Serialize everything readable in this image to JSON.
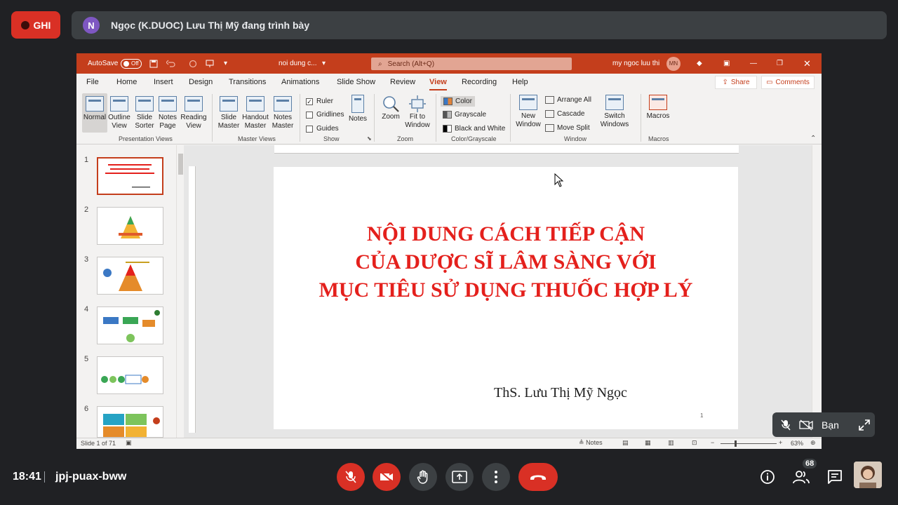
{
  "meet": {
    "record_label": "GHI",
    "presenter_initial": "N",
    "presenter_text": "Ngọc (K.DUOC) Lưu Thị Mỹ đang trình bày",
    "self_label": "Bạn",
    "time": "18:41",
    "meeting_code": "jpj-puax-bww",
    "participants_count": "68",
    "colors": {
      "end_call": "#d93025",
      "bg": "#202124",
      "avatar": "#7e57c2"
    }
  },
  "ppt": {
    "autosave_label": "AutoSave",
    "autosave_state": "Off",
    "file_name": "noi dung c...",
    "search_placeholder": "Search (Alt+Q)",
    "user_name": "my ngoc luu thi",
    "user_initials": "MN",
    "menu": [
      "File",
      "Home",
      "Insert",
      "Design",
      "Transitions",
      "Animations",
      "Slide Show",
      "Review",
      "View",
      "Recording",
      "Help"
    ],
    "active_menu": "View",
    "share_label": "Share",
    "comments_label": "Comments",
    "ribbon": {
      "presentation_views": {
        "label": "Presentation Views",
        "items": [
          "Normal",
          "Outline View",
          "Slide Sorter",
          "Notes Page",
          "Reading View"
        ]
      },
      "master_views": {
        "label": "Master Views",
        "items": [
          "Slide Master",
          "Handout Master",
          "Notes Master"
        ]
      },
      "show": {
        "label": "Show",
        "ruler": "Ruler",
        "gridlines": "Gridlines",
        "guides": "Guides",
        "notes": "Notes"
      },
      "zoom": {
        "label": "Zoom",
        "zoom": "Zoom",
        "fit": "Fit to Window"
      },
      "color": {
        "label": "Color/Grayscale",
        "color": "Color",
        "grayscale": "Grayscale",
        "bw": "Black and White"
      },
      "window": {
        "label": "Window",
        "new_window": "New Window",
        "arrange_all": "Arrange All",
        "cascade": "Cascade",
        "move_split": "Move Split",
        "switch": "Switch Windows"
      },
      "macros": {
        "label": "Macros",
        "macros": "Macros"
      }
    },
    "thumb_numbers": [
      "1",
      "2",
      "3",
      "4",
      "5",
      "6"
    ],
    "slide": {
      "title_lines": [
        "NỘI DUNG CÁCH TIẾP CẬN",
        "CỦA DƯỢC SĨ LÂM SÀNG VỚI",
        "MỤC TIÊU SỬ DỤNG THUỐC HỢP LÝ"
      ],
      "author": "ThS. Lưu Thị Mỹ Ngọc",
      "number": "1",
      "title_color": "#e4201c"
    },
    "status": {
      "slide_of": "Slide 1 of 71",
      "notes": "Notes",
      "zoom": "63%"
    },
    "accent": "#c43e1c"
  }
}
